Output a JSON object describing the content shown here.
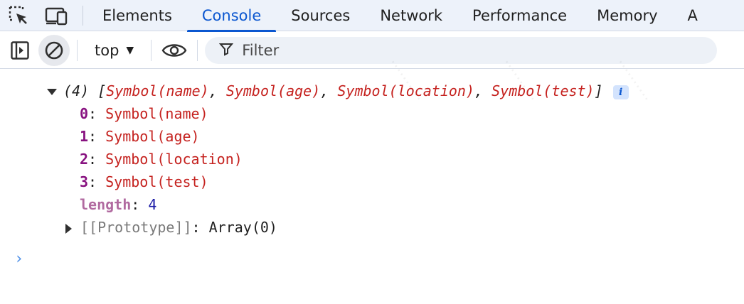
{
  "tabs": [
    {
      "label": "Elements",
      "active": false
    },
    {
      "label": "Console",
      "active": true
    },
    {
      "label": "Sources",
      "active": false
    },
    {
      "label": "Network",
      "active": false
    },
    {
      "label": "Performance",
      "active": false
    },
    {
      "label": "Memory",
      "active": false
    },
    {
      "label": "A",
      "active": false
    }
  ],
  "toolbar": {
    "context": "top",
    "filter_placeholder": "Filter"
  },
  "console": {
    "summary": {
      "count": "(4)",
      "open_bracket": "[",
      "items": [
        "Symbol(name)",
        "Symbol(age)",
        "Symbol(location)",
        "Symbol(test)"
      ],
      "close_bracket": "]",
      "info": "i"
    },
    "entries": [
      {
        "key": "0",
        "value": "Symbol(name)"
      },
      {
        "key": "1",
        "value": "Symbol(age)"
      },
      {
        "key": "2",
        "value": "Symbol(location)"
      },
      {
        "key": "3",
        "value": "Symbol(test)"
      }
    ],
    "length": {
      "key": "length",
      "value": "4"
    },
    "prototype": {
      "key": "[[Prototype]]",
      "value": "Array(0)"
    },
    "prompt": "›"
  },
  "colors": {
    "accent": "#0b57d0",
    "symbol": "#c5221f",
    "index": "#881280",
    "number": "#1a1aa6"
  }
}
